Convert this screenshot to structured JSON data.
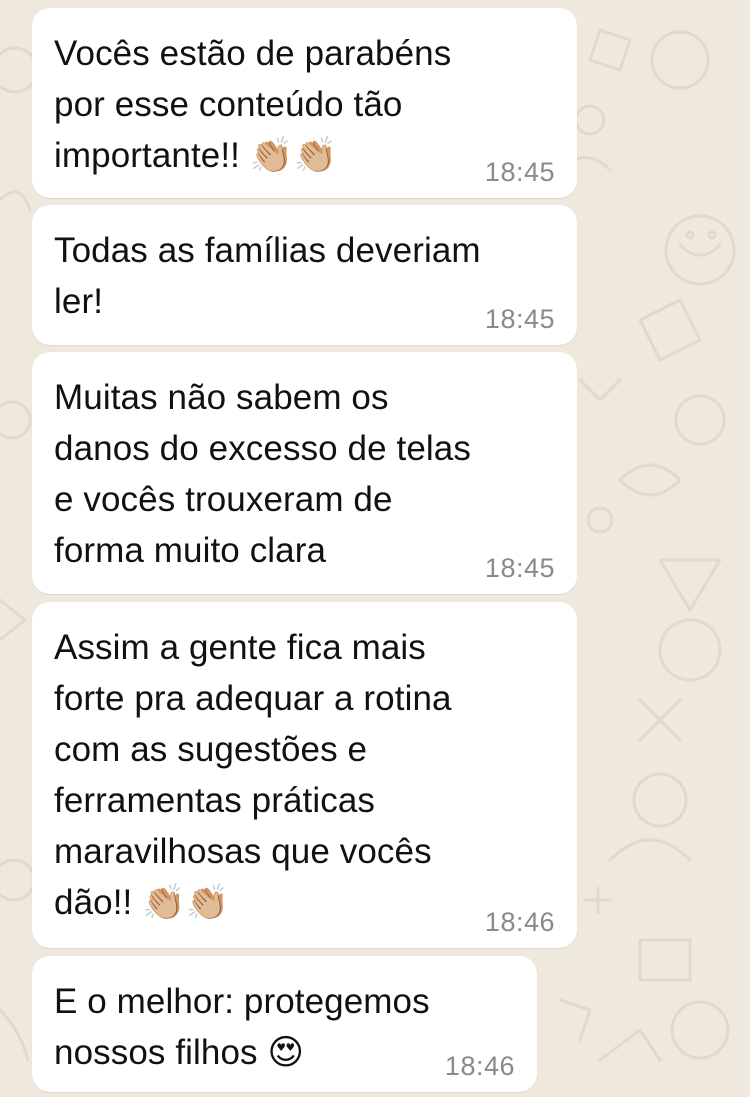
{
  "conversation": {
    "messages": [
      {
        "text": "Vocês estão de parabéns\npor esse conteúdo tão\nimportante!! 👏🏼👏🏼",
        "time": "18:45"
      },
      {
        "text": "Todas as famílias deveriam\nler!",
        "time": "18:45"
      },
      {
        "text": "Muitas não sabem os\ndanos do excesso de telas\ne vocês trouxeram de\nforma muito clara",
        "time": "18:45"
      },
      {
        "text": "Assim a gente fica mais\nforte pra adequar a rotina\ncom as sugestões e\nferramentas práticas\nmaravilhosas que vocês\ndão!! 👏🏼👏🏼",
        "time": "18:46"
      },
      {
        "text": "E o melhor: protegemos\nnossos filhos 😍",
        "time": "18:46"
      }
    ]
  },
  "theme": {
    "wallpaper_color": "#efe8dd",
    "doodle_color": "#e4dccd",
    "bubble_color": "#ffffff",
    "text_color": "#111111",
    "time_color": "#8a8a8a"
  }
}
